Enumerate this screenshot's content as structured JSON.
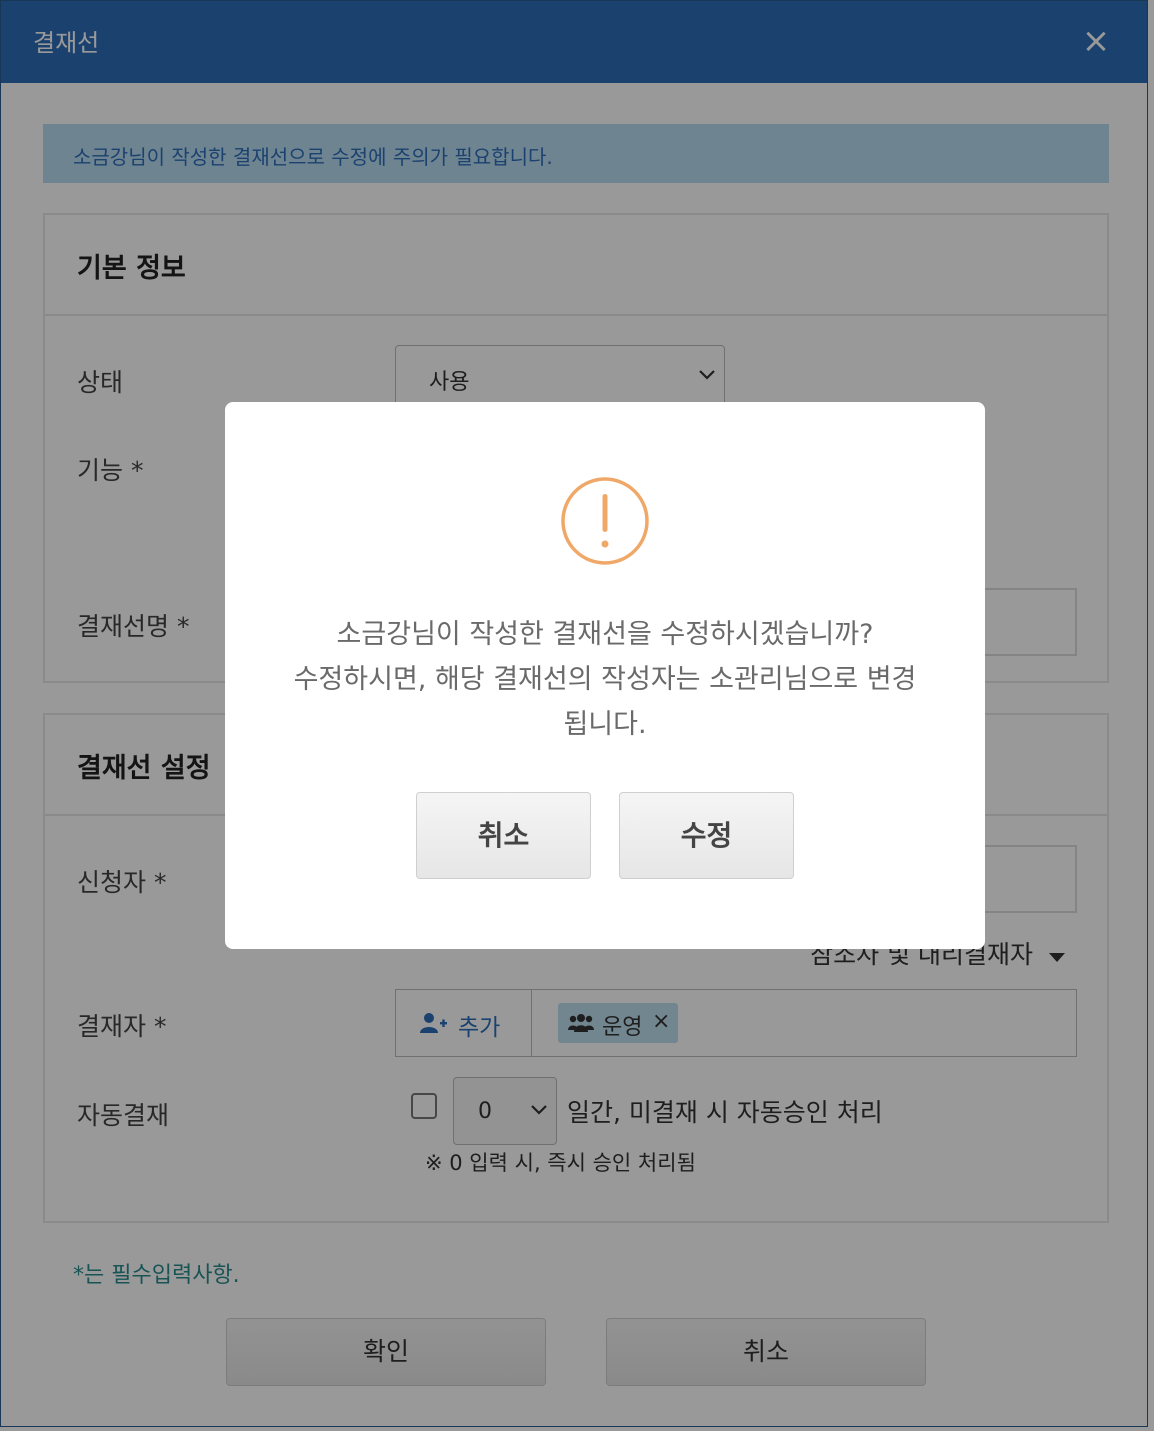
{
  "window": {
    "title": "결재선",
    "close_symbol": "×"
  },
  "notice": "소금강님이 작성한 결재선으로 수정에 주의가 필요합니다.",
  "basic_info": {
    "title": "기본 정보",
    "status_label": "상태",
    "status_value": "사용",
    "function_label": "기능 *",
    "name_label": "결재선명 *"
  },
  "approval_settings": {
    "title": "결재선 설정",
    "applicant_label": "신청자 *",
    "reference_toggle": "참조자 및 대리결재자",
    "approver_label": "결재자 *",
    "add_label": "추가",
    "approver_tag": "운영",
    "auto_label": "자동결재",
    "auto_days": "0",
    "auto_text": "일간, 미결재 시 자동승인 처리",
    "auto_note": "※ 0 입력 시, 즉시 승인 처리됨"
  },
  "required_note": "*는 필수입력사항.",
  "footer": {
    "confirm": "확인",
    "cancel": "취소"
  },
  "dialog": {
    "line1": "소금강님이 작성한 결재선을 수정하시겠습니까?",
    "line2": "수정하시면, 해당 결재선의 작성자는 소관리님으로 변경",
    "line3": "됩니다.",
    "cancel": "취소",
    "edit": "수정"
  },
  "colors": {
    "titlebar": "#2e6fba",
    "warning": "#f0a868",
    "required_note": "#2a8c8c"
  }
}
